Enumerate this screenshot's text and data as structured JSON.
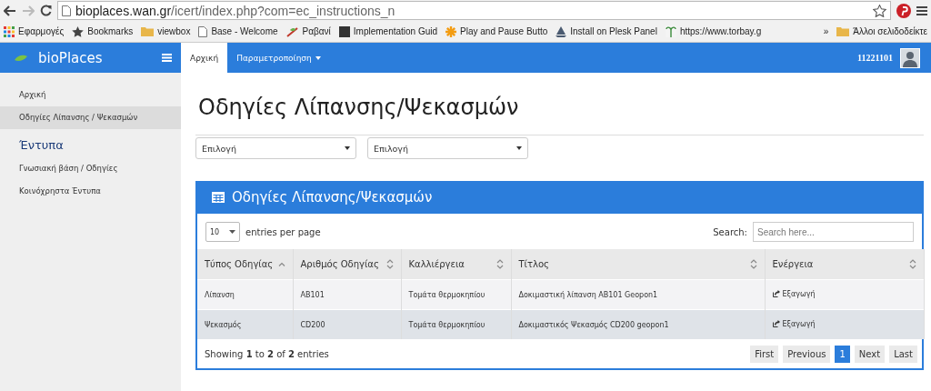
{
  "browser": {
    "url_host": "bioplaces.wan.gr",
    "url_path": "/icert/index.php?com=ec_instructions_n",
    "bookmarks": [
      {
        "label": "Εφαρμογές",
        "kind": "apps"
      },
      {
        "label": "Bookmarks",
        "kind": "star"
      },
      {
        "label": "viewbox",
        "kind": "folder"
      },
      {
        "label": "Base - Welcome",
        "kind": "page"
      },
      {
        "label": "Ραβανί",
        "kind": "plant"
      },
      {
        "label": "Implementation Guid",
        "kind": "dark"
      },
      {
        "label": "Play and Pause Butto",
        "kind": "asterisk"
      },
      {
        "label": "Install on Plesk Panel",
        "kind": "ship"
      },
      {
        "label": "https://www.torbay.g",
        "kind": "palm"
      }
    ],
    "overflow": "»",
    "other_bookmarks": "Άλλοι σελιδοδείκτε"
  },
  "navbar": {
    "brand": "bioPlaces",
    "tabs": [
      {
        "label": "Αρχική",
        "selected": true,
        "dropdown": false
      },
      {
        "label": "Παραμετροποίηση",
        "selected": false,
        "dropdown": true
      }
    ],
    "user": "11221101"
  },
  "sidebar": {
    "items": [
      {
        "kind": "link",
        "label": "Αρχική",
        "selected": false
      },
      {
        "kind": "link",
        "label": "Οδηγίες Λίπανσης / Ψεκασμών",
        "selected": true
      },
      {
        "kind": "heading",
        "label": "Έντυπα"
      },
      {
        "kind": "link",
        "label": "Γνωσιακή βάση / Οδηγίες",
        "selected": false
      },
      {
        "kind": "link",
        "label": "Κοινόχρηστα Έντυπα",
        "selected": false
      }
    ]
  },
  "page": {
    "title": "Οδηγίες Λίπανσης/Ψεκασμών",
    "filters": [
      {
        "value": "Επιλογή"
      },
      {
        "value": "Επιλογή"
      }
    ],
    "panel": {
      "title": "Οδηγίες Λίπανσης/Ψεκασμών",
      "page_size": "10",
      "length_label": "entries per page",
      "search_label": "Search:",
      "search_placeholder": "Search here...",
      "columns": [
        {
          "label": "Τύπος Οδηγίας",
          "sorted": true
        },
        {
          "label": "Αριθμός Οδηγίας",
          "sorted": false
        },
        {
          "label": "Καλλιέργεια",
          "sorted": false
        },
        {
          "label": "Τίτλος",
          "sorted": false
        },
        {
          "label": "Ενέργεια",
          "sorted": false
        }
      ],
      "rows": [
        {
          "cells": [
            "Λίπανση",
            "AB101",
            "Τομάτα θερμοκηπίου",
            "Δοκιμαστική λίπανση AB101 Geopon1"
          ],
          "action": "Εξαγωγή",
          "highlighted": false
        },
        {
          "cells": [
            "Ψεκασμός",
            "CD200",
            "Τομάτα θερμοκηπίου",
            "Δοκιμαστικός Ψεκασμός CD200 geopon1"
          ],
          "action": "Εξαγωγή",
          "highlighted": true
        }
      ],
      "info": "Showing **1** to **2** of **2** entries",
      "pagination": [
        {
          "label": "First",
          "selected": false
        },
        {
          "label": "Previous",
          "selected": false
        },
        {
          "label": "1",
          "selected": true
        },
        {
          "label": "Next",
          "selected": false
        },
        {
          "label": "Last",
          "selected": false
        }
      ]
    }
  }
}
